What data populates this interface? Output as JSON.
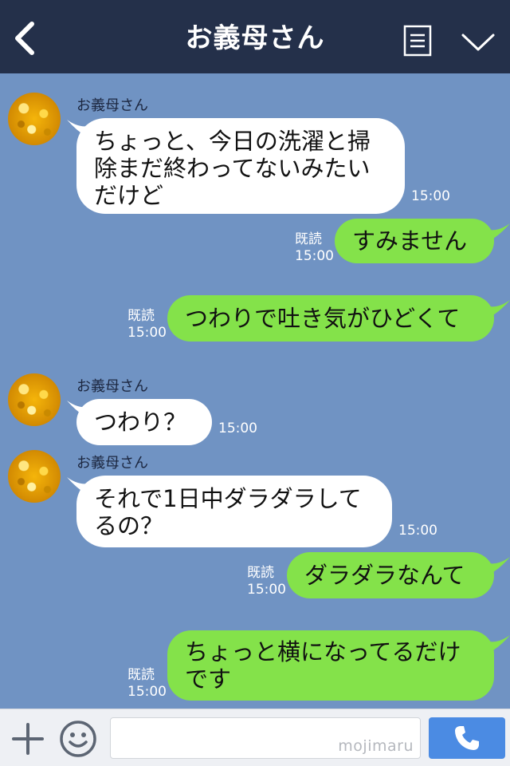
{
  "header": {
    "title": "お義母さん",
    "back_icon": "chevron-left-icon",
    "menu_icon": "document-menu-icon",
    "dropdown_icon": "chevron-down-icon"
  },
  "messages": [
    {
      "side": "left",
      "sender": "お義母さん",
      "text": "ちょっと、今日の洗濯と掃除まだ終わってないみたいだけど",
      "time": "15:00"
    },
    {
      "side": "right",
      "text": "すみません",
      "read": "既読",
      "time": "15:00"
    },
    {
      "side": "right",
      "text": "つわりで吐き気がひどくて",
      "read": "既読",
      "time": "15:00"
    },
    {
      "side": "left",
      "sender": "お義母さん",
      "text": "つわり？",
      "time": "15:00"
    },
    {
      "side": "left",
      "sender": "お義母さん",
      "text": "それで1日中ダラダラしてるの？",
      "time": "15:00"
    },
    {
      "side": "right",
      "text": "ダラダラなんて",
      "read": "既読",
      "time": "15:00"
    },
    {
      "side": "right",
      "text": "ちょっと横になってるだけです",
      "read": "既読",
      "time": "15:00"
    }
  ],
  "footer": {
    "plus_icon": "plus-icon",
    "emoji_icon": "smiley-icon",
    "input_value": "",
    "watermark": "mojimaru",
    "call_icon": "phone-icon"
  },
  "colors": {
    "header_bg": "#24304a",
    "chat_bg": "#7093c3",
    "my_bubble": "#84e24a",
    "their_bubble": "#ffffff",
    "call_button": "#4b8be3"
  }
}
